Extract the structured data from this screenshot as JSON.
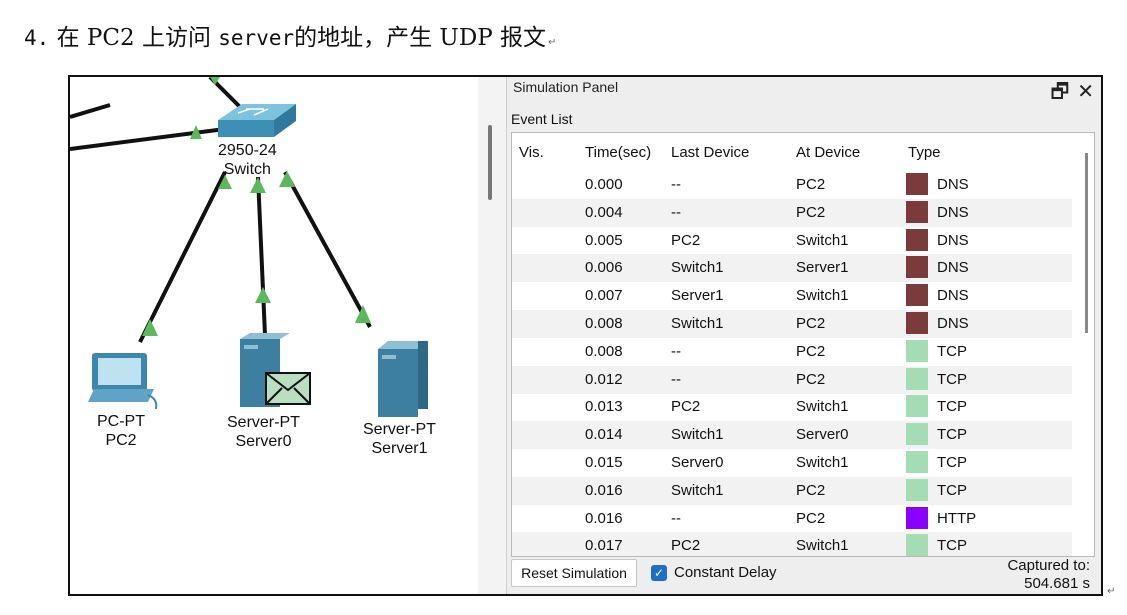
{
  "heading": {
    "number": "4.",
    "text_a": "在 PC2 上访问",
    "text_code": "server",
    "text_b": "的地址，产生 UDP 报文",
    "mark": "↵"
  },
  "end_mark": "↵",
  "topology": {
    "switch": {
      "model": "2950-24",
      "name": "Switch"
    },
    "pc": {
      "type": "PC-PT",
      "name": "PC2"
    },
    "server0": {
      "type": "Server-PT",
      "name": "Server0"
    },
    "server1": {
      "type": "Server-PT",
      "name": "Server1"
    },
    "link_color": "#111111",
    "indicator_color": "#5cb85c",
    "envelope_color": "#b8e0c0"
  },
  "panel": {
    "title": "Simulation Panel",
    "restore_icon": "restore-window-icon",
    "close_icon": "close-icon",
    "event_list_label": "Event List",
    "columns": [
      "Vis.",
      "Time(sec)",
      "Last Device",
      "At Device",
      "Type"
    ],
    "events": [
      {
        "time": "0.000",
        "last": "--",
        "at": "PC2",
        "type": "DNS",
        "color": "#7b3b3b"
      },
      {
        "time": "0.004",
        "last": "--",
        "at": "PC2",
        "type": "DNS",
        "color": "#7b3b3b"
      },
      {
        "time": "0.005",
        "last": "PC2",
        "at": "Switch1",
        "type": "DNS",
        "color": "#7b3b3b"
      },
      {
        "time": "0.006",
        "last": "Switch1",
        "at": "Server1",
        "type": "DNS",
        "color": "#7b3b3b"
      },
      {
        "time": "0.007",
        "last": "Server1",
        "at": "Switch1",
        "type": "DNS",
        "color": "#7b3b3b"
      },
      {
        "time": "0.008",
        "last": "Switch1",
        "at": "PC2",
        "type": "DNS",
        "color": "#7b3b3b"
      },
      {
        "time": "0.008",
        "last": "--",
        "at": "PC2",
        "type": "TCP",
        "color": "#a4dcb4"
      },
      {
        "time": "0.012",
        "last": "--",
        "at": "PC2",
        "type": "TCP",
        "color": "#a4dcb4"
      },
      {
        "time": "0.013",
        "last": "PC2",
        "at": "Switch1",
        "type": "TCP",
        "color": "#a4dcb4"
      },
      {
        "time": "0.014",
        "last": "Switch1",
        "at": "Server0",
        "type": "TCP",
        "color": "#a4dcb4"
      },
      {
        "time": "0.015",
        "last": "Server0",
        "at": "Switch1",
        "type": "TCP",
        "color": "#a4dcb4"
      },
      {
        "time": "0.016",
        "last": "Switch1",
        "at": "PC2",
        "type": "TCP",
        "color": "#a4dcb4"
      },
      {
        "time": "0.016",
        "last": "--",
        "at": "PC2",
        "type": "HTTP",
        "color": "#8b00ff"
      },
      {
        "time": "0.017",
        "last": "PC2",
        "at": "Switch1",
        "type": "TCP",
        "color": "#a4dcb4"
      }
    ],
    "reset_label": "Reset Simulation",
    "constant_delay_label": "Constant Delay",
    "constant_delay_checked": true,
    "captured_label": "Captured to:",
    "captured_value": "504.681 s"
  }
}
